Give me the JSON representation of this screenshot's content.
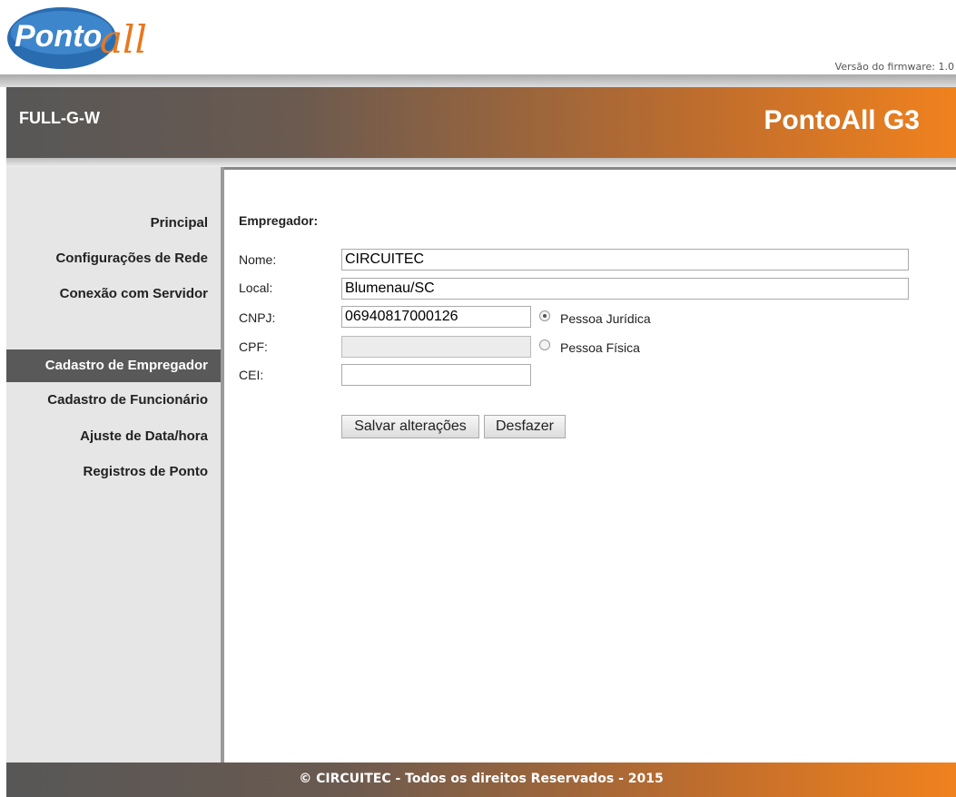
{
  "header": {
    "logo_text": "PontoAll",
    "firmware": "Versão do firmware: 1.0",
    "device": "FULL-G-W",
    "product": "PontoAll G3"
  },
  "sidebar": {
    "items": [
      {
        "label": "Principal",
        "active": false
      },
      {
        "label": "Configurações de Rede",
        "active": false
      },
      {
        "label": "Conexão com Servidor",
        "active": false
      },
      {
        "label": "Cadastro de Empregador",
        "active": true
      },
      {
        "label": "Cadastro de Funcionário",
        "active": false
      },
      {
        "label": "Ajuste de Data/hora",
        "active": false
      },
      {
        "label": "Registros de Ponto",
        "active": false
      }
    ]
  },
  "form": {
    "heading": "Empregador:",
    "nome_label": "Nome:",
    "nome_value": "CIRCUITEC",
    "local_label": "Local:",
    "local_value": "Blumenau/SC",
    "cnpj_label": "CNPJ:",
    "cnpj_value": "06940817000126",
    "cpf_label": "CPF:",
    "cpf_value": "",
    "cei_label": "CEI:",
    "cei_value": "",
    "radio_juridica": "Pessoa Jurídica",
    "radio_fisica": "Pessoa Física",
    "selected_person_type": "Pessoa Jurídica",
    "save_label": "Salvar alterações",
    "undo_label": "Desfazer"
  },
  "footer": {
    "text": "© CIRCUITEC - Todos os direitos Reservados - 2015"
  },
  "colors": {
    "accent_orange": "#f0821e",
    "banner_gray": "#575757",
    "logo_blue": "#2a6cb0"
  }
}
